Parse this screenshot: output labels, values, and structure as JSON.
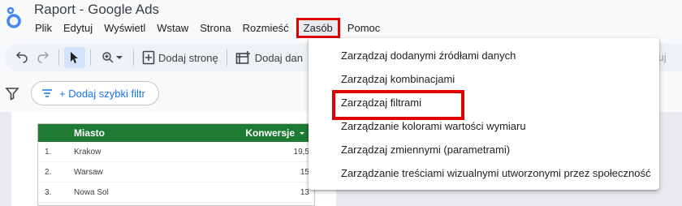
{
  "app": {
    "title": "Raport - Google Ads"
  },
  "menubar": {
    "items": [
      "Plik",
      "Edytuj",
      "Wyświetl",
      "Wstaw",
      "Strona",
      "Rozmieść",
      "Zasób",
      "Pomoc"
    ],
    "active": "Zasób"
  },
  "toolbar": {
    "add_page_label": "Dodaj stronę",
    "add_data_label": "Dodaj dan",
    "right_label": "zuj"
  },
  "filterbar": {
    "quick_filter_label": "+ Dodaj szybki filtr"
  },
  "table": {
    "headers": {
      "city": "Miasto",
      "conversions": "Konwersje"
    },
    "rows": [
      {
        "index": "1.",
        "city": "Krakow",
        "value": "19,5"
      },
      {
        "index": "2.",
        "city": "Warsaw",
        "value": "15"
      },
      {
        "index": "3.",
        "city": "Nowa Sol",
        "value": "13"
      }
    ],
    "header_color": "#1e7b34"
  },
  "dropdown": {
    "items": [
      "Zarządzaj dodanymi źródłami danych",
      "Zarządzaj kombinacjami",
      "Zarządzaj filtrami",
      "Zarządzanie kolorami wartości wymiaru",
      "Zarządzaj zmiennymi (parametrami)",
      "Zarządzanie treściami wizualnymi utworzonymi przez społeczność"
    ],
    "highlighted": "Zarządzaj filtrami"
  },
  "colors": {
    "highlight": "#e00000",
    "accent": "#1a73e8"
  },
  "icons": [
    "looker-studio-logo-icon",
    "undo-icon",
    "redo-icon",
    "select-cursor-icon",
    "zoom-icon",
    "chevron-down-icon",
    "add-page-icon",
    "add-data-icon",
    "filter-icon"
  ]
}
